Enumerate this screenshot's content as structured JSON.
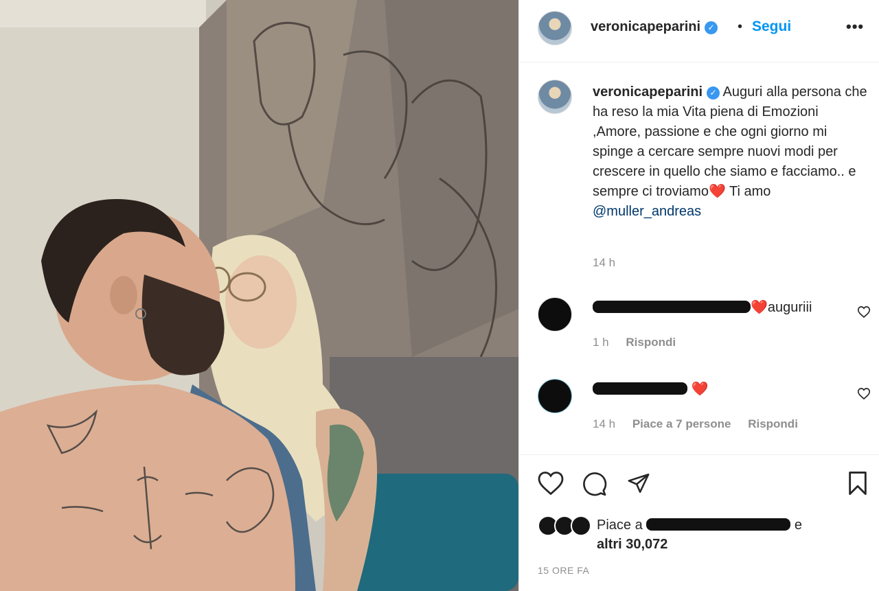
{
  "header": {
    "username": "veronicapeparini",
    "verified_mark": "✓",
    "separator": "•",
    "follow_label": "Segui",
    "more_label": "•••"
  },
  "caption": {
    "username": "veronicapeparini",
    "verified_mark": "✓",
    "text": "Auguri alla persona che ha reso la mia Vita piena di Emozioni ,Amore, passione e che ogni giorno mi spinge a cercare sempre nuovi modi per crescere in quello che siamo e facciamo.. e sempre ci troviamo",
    "heart": "❤️",
    "text_after": " Ti amo ",
    "mention": "@muller_andreas",
    "time": "14 h"
  },
  "comments": [
    {
      "text": "auguriii",
      "heart": "❤️",
      "time": "1 h",
      "reply_label": "Rispondi",
      "like_icon": "heart-outline-icon"
    },
    {
      "text": "",
      "heart": "❤️",
      "time": "14 h",
      "likes_label": "Piace a 7 persone",
      "reply_label": "Rispondi",
      "like_icon": "heart-outline-icon"
    }
  ],
  "actions": {
    "icons": [
      "heart-icon",
      "comment-icon",
      "share-icon",
      "bookmark-icon"
    ]
  },
  "likes": {
    "prefix": "Piace a",
    "suffix": "e",
    "others": "altri 30,072"
  },
  "posted": "15 ORE FA",
  "colors": {
    "link_blue": "#0095f6",
    "mention": "#00376b",
    "muted": "#8e8e8e",
    "heart": "#e0245e"
  }
}
